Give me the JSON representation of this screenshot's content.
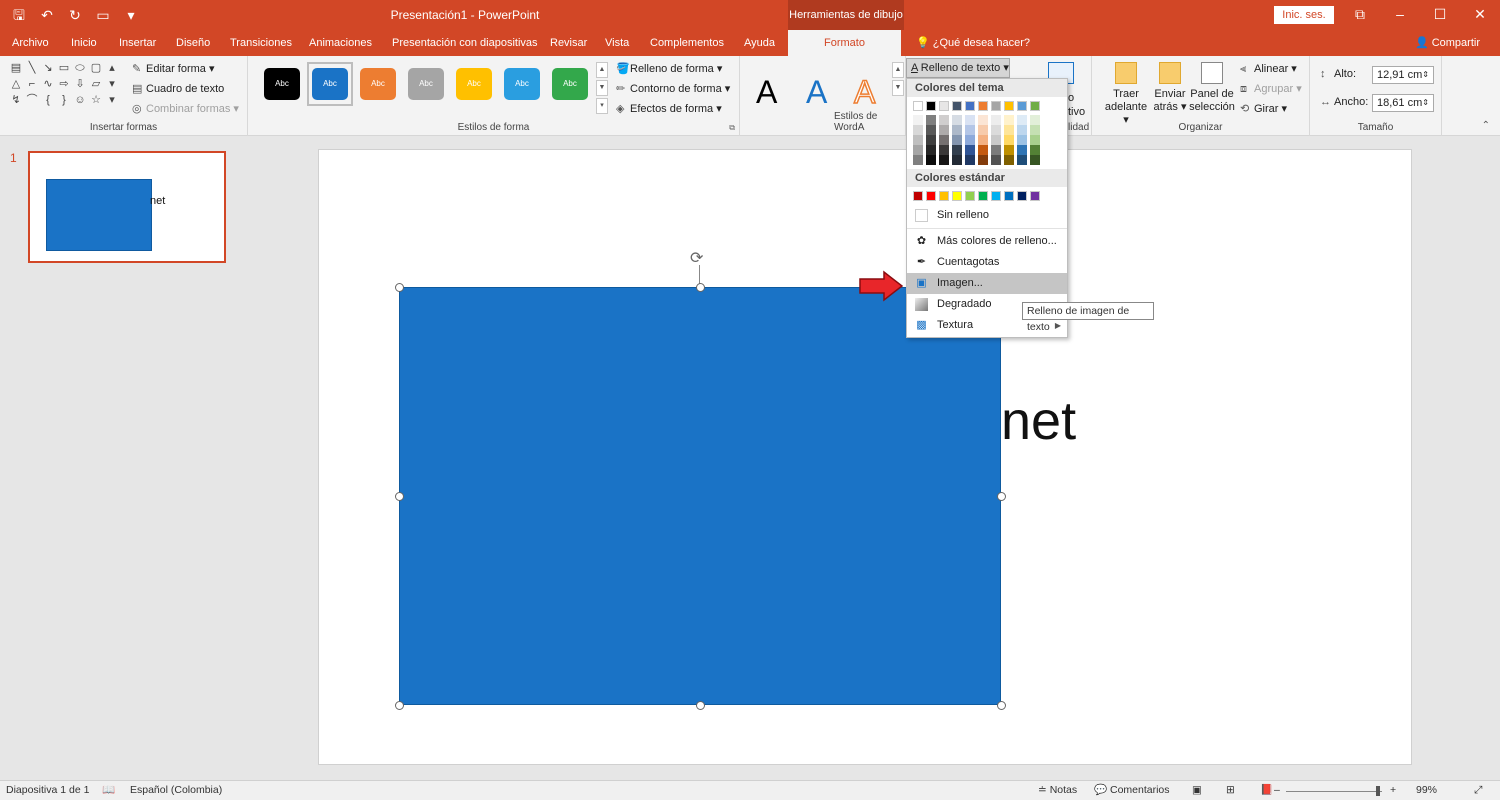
{
  "titlebar": {
    "title": "Presentación1 - PowerPoint",
    "context_tab_title": "Herramientas de dibujo",
    "sign_in": "Inic. ses."
  },
  "tabs": [
    "Archivo",
    "Inicio",
    "Insertar",
    "Diseño",
    "Transiciones",
    "Animaciones",
    "Presentación con diapositivas",
    "Revisar",
    "Vista",
    "Complementos",
    "Ayuda"
  ],
  "active_tab": "Formato",
  "tell_me": "¿Qué desea hacer?",
  "share": "Compartir",
  "ribbon": {
    "insert_shapes": {
      "label": "Insertar formas",
      "edit_shape": "Editar forma",
      "text_box": "Cuadro de texto",
      "merge_shapes": "Combinar formas"
    },
    "shape_styles": {
      "label": "Estilos de forma",
      "swatch_text": "Abc",
      "swatches": [
        "#000000",
        "#1a73c6",
        "#ed7d31",
        "#a5a5a5",
        "#ffc000",
        "#2a9ee0",
        "#33a84b"
      ],
      "shape_fill": "Relleno de forma",
      "shape_outline": "Contorno de forma",
      "shape_effects": "Efectos de forma"
    },
    "wordart": {
      "label": "Estilos de WordA",
      "letter": "A",
      "text_fill": "Relleno de texto"
    },
    "accessibility": {
      "partial_text": "o",
      "partial_text2": "tivo",
      "label_partial": "lidad"
    },
    "arrange": {
      "label": "Organizar",
      "bring_forward": "Traer adelante",
      "send_backward": "Enviar atrás",
      "selection_pane": "Panel de selección",
      "align": "Alinear",
      "group": "Agrupar",
      "rotate": "Girar"
    },
    "size": {
      "label": "Tamaño",
      "height_label": "Alto:",
      "height_value": "12,91 cm",
      "width_label": "Ancho:",
      "width_value": "18,61 cm"
    }
  },
  "dropdown": {
    "theme_colors_header": "Colores del tema",
    "theme_colors_top": [
      "#ffffff",
      "#000000",
      "#e7e6e6",
      "#44546a",
      "#4472c4",
      "#ed7d31",
      "#a5a5a5",
      "#ffc000",
      "#5b9bd5",
      "#70ad47"
    ],
    "theme_shades": [
      [
        "#f2f2f2",
        "#7f7f7f",
        "#d0cece",
        "#d6dce4",
        "#d9e2f3",
        "#fbe5d5",
        "#ededed",
        "#fff2cc",
        "#deebf6",
        "#e2efd9"
      ],
      [
        "#d8d8d8",
        "#595959",
        "#aeabab",
        "#adb9ca",
        "#b4c6e7",
        "#f7cbac",
        "#dbdbdb",
        "#fee599",
        "#bdd7ee",
        "#c5e0b3"
      ],
      [
        "#bfbfbf",
        "#3f3f3f",
        "#757070",
        "#8496b0",
        "#8eaadb",
        "#f4b183",
        "#c9c9c9",
        "#ffd965",
        "#9cc3e5",
        "#a8d08d"
      ],
      [
        "#a5a5a5",
        "#262626",
        "#3a3838",
        "#323f4f",
        "#2f5496",
        "#c55a11",
        "#7b7b7b",
        "#bf9000",
        "#2e75b5",
        "#538135"
      ],
      [
        "#7f7f7f",
        "#0c0c0c",
        "#171616",
        "#222a35",
        "#1f3864",
        "#833c0b",
        "#525252",
        "#7f6000",
        "#1e4e79",
        "#375623"
      ]
    ],
    "standard_colors_header": "Colores estándar",
    "standard_colors": [
      "#c00000",
      "#ff0000",
      "#ffc000",
      "#ffff00",
      "#92d050",
      "#00b050",
      "#00b0f0",
      "#0070c0",
      "#002060",
      "#7030a0"
    ],
    "no_fill": "Sin relleno",
    "more_colors": "Más colores de relleno...",
    "eyedropper": "Cuentagotas",
    "picture": "Imagen...",
    "gradient": "Degradado",
    "texture": "Textura"
  },
  "tooltip": "Relleno de imagen de texto",
  "slides": {
    "number": "1",
    "text": "net"
  },
  "status": {
    "slide_info": "Diapositiva 1 de 1",
    "language": "Español (Colombia)",
    "notes": "Notas",
    "comments": "Comentarios",
    "zoom": "99%"
  }
}
